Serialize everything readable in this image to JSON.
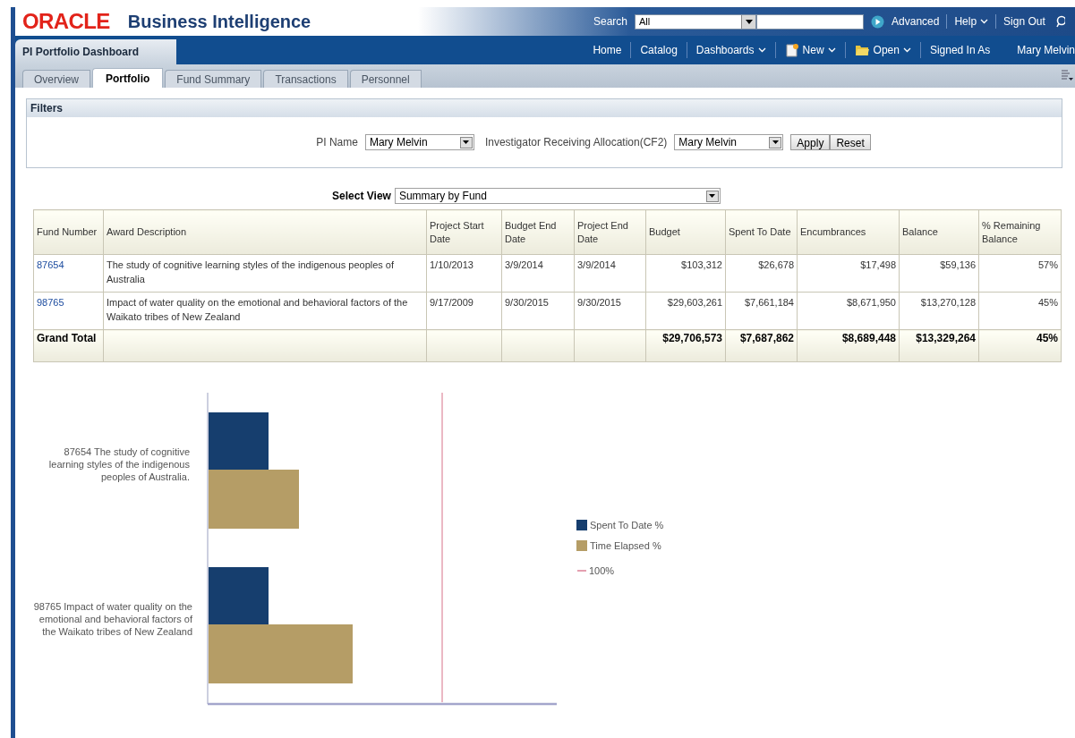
{
  "header": {
    "logo": "ORACLE",
    "product": "Business Intelligence",
    "search_label": "Search",
    "search_scope": "All",
    "links": [
      "Advanced",
      "Help",
      "Sign Out"
    ]
  },
  "nav": {
    "dashboard_title": "PI Portfolio Dashboard",
    "items": [
      {
        "label": "Home",
        "kind": "link"
      },
      {
        "label": "Catalog",
        "kind": "link"
      },
      {
        "label": "Dashboards",
        "kind": "menu"
      },
      {
        "label": "New",
        "kind": "new"
      },
      {
        "label": "Open",
        "kind": "open"
      },
      {
        "label": "Signed In As",
        "kind": "link"
      },
      {
        "label": "Mary Melvin",
        "kind": "user"
      }
    ]
  },
  "tabs": [
    {
      "label": "Overview",
      "selected": false
    },
    {
      "label": "Portfolio",
      "selected": true
    },
    {
      "label": "Fund Summary",
      "selected": false
    },
    {
      "label": "Transactions",
      "selected": false
    },
    {
      "label": "Personnel",
      "selected": false
    }
  ],
  "filters": {
    "title": "Filters",
    "pi_label": "PI Name",
    "pi_value": "Mary Melvin",
    "inv_label": "Investigator Receiving Allocation(CF2)",
    "inv_value": "Mary Melvin",
    "buttons": [
      "Apply",
      "Reset"
    ]
  },
  "select_view": {
    "label": "Select View",
    "value": "Summary by Fund"
  },
  "table": {
    "columns": [
      "Fund Number",
      "Award Description",
      "Project Start Date",
      "Budget End Date",
      "Project End Date",
      "Budget",
      "Spent To Date",
      "Encumbrances",
      "Balance",
      "% Remaining Balance"
    ],
    "rows": [
      [
        "87654",
        "The study of cognitive learning styles of the indigenous peoples of Australia",
        "1/10/2013",
        "3/9/2014",
        "3/9/2014",
        "$103,312",
        "$26,678",
        "$17,498",
        "$59,136",
        "57%"
      ],
      [
        "98765",
        "Impact of water quality on the emotional and behavioral factors of the Waikato tribes of New Zealand",
        "9/17/2009",
        "9/30/2015",
        "9/30/2015",
        "$29,603,261",
        "$7,661,184",
        "$8,671,950",
        "$13,270,128",
        "45%"
      ]
    ],
    "total": {
      "label": "Grand Total",
      "values": [
        "$29,706,573",
        "$7,687,862",
        "$8,689,448",
        "$13,329,264",
        "45%"
      ]
    }
  },
  "chart": {
    "categories": [
      "87654 The study of cognitive learning styles of the indigenous peoples of Australia.",
      "98765 Impact of water quality on the emotional and behavioral factors of the Waikato tribes of New Zealand"
    ],
    "legend": [
      {
        "label": "Spent To Date %",
        "kind": "box",
        "color": "#163e6e"
      },
      {
        "label": "Time Elapsed %",
        "kind": "box",
        "color": "#b59d66"
      },
      {
        "label": "100%",
        "kind": "line",
        "color": "#e4a0b0"
      }
    ]
  }
}
